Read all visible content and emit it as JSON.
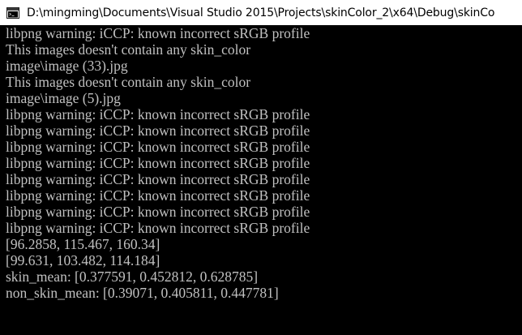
{
  "window": {
    "title": "D:\\mingming\\Documents\\Visual Studio 2015\\Projects\\skinColor_2\\x64\\Debug\\skinCo",
    "icon": "console-app-icon",
    "colors": {
      "titlebar_bg": "#ffffff",
      "console_bg": "#000000",
      "console_text": "#c0c0c0"
    }
  },
  "console": {
    "lines": [
      "libpng warning: iCCP: known incorrect sRGB profile",
      "This images doesn't contain any skin_color",
      "image\\image (33).jpg",
      "This images doesn't contain any skin_color",
      "image\\image (5).jpg",
      "libpng warning: iCCP: known incorrect sRGB profile",
      "libpng warning: iCCP: known incorrect sRGB profile",
      "libpng warning: iCCP: known incorrect sRGB profile",
      "libpng warning: iCCP: known incorrect sRGB profile",
      "libpng warning: iCCP: known incorrect sRGB profile",
      "libpng warning: iCCP: known incorrect sRGB profile",
      "libpng warning: iCCP: known incorrect sRGB profile",
      "libpng warning: iCCP: known incorrect sRGB profile",
      "[96.2858, 115.467, 160.34]",
      "[99.631, 103.482, 114.184]",
      "skin_mean: [0.377591, 0.452812, 0.628785]",
      "non_skin_mean: [0.39071, 0.405811, 0.447781]"
    ]
  }
}
